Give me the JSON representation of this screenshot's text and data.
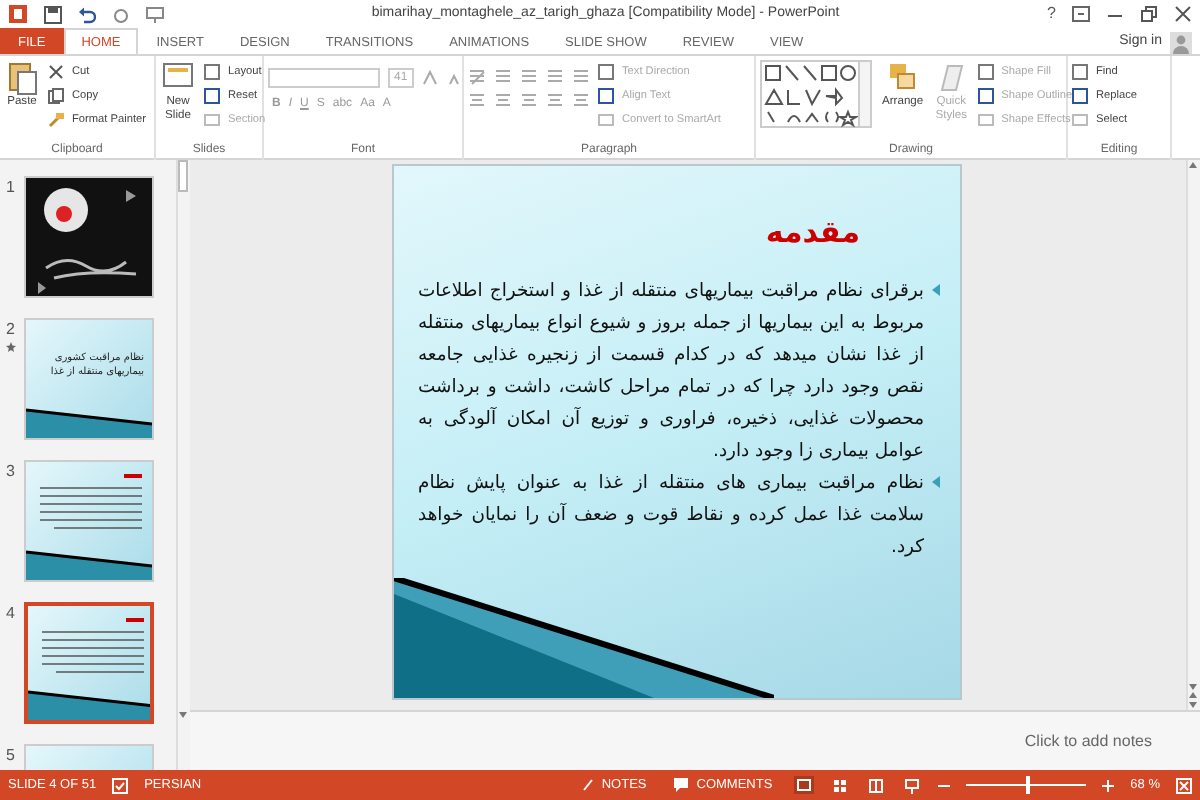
{
  "window": {
    "title": "bimarihay_montaghele_az_tarigh_ghaza [Compatibility Mode] - PowerPoint",
    "help": "?"
  },
  "tabs": [
    {
      "label": "FILE",
      "kind": "file",
      "selected": false
    },
    {
      "label": "HOME",
      "kind": "tab",
      "selected": true
    },
    {
      "label": "INSERT",
      "kind": "tab",
      "selected": false
    },
    {
      "label": "DESIGN",
      "kind": "tab",
      "selected": false
    },
    {
      "label": "TRANSITIONS",
      "kind": "tab",
      "selected": false
    },
    {
      "label": "ANIMATIONS",
      "kind": "tab",
      "selected": false
    },
    {
      "label": "SLIDE SHOW",
      "kind": "tab",
      "selected": false
    },
    {
      "label": "REVIEW",
      "kind": "tab",
      "selected": false
    },
    {
      "label": "VIEW",
      "kind": "tab",
      "selected": false
    }
  ],
  "account": {
    "label": "Sign in"
  },
  "ribbon": {
    "groups": [
      {
        "label": "Clipboard",
        "kind": "clipboard",
        "large": [
          {
            "label": "Paste",
            "disabled": false
          }
        ],
        "items": [
          {
            "label": "Cut",
            "disabled": false
          },
          {
            "label": "Copy",
            "disabled": false
          },
          {
            "label": "Format Painter",
            "disabled": false
          }
        ]
      },
      {
        "label": "Slides",
        "kind": "slides",
        "large": [
          {
            "label": "New Slide",
            "disabled": false
          }
        ],
        "items": [
          {
            "label": "Layout",
            "disabled": false
          },
          {
            "label": "Reset",
            "disabled": false
          },
          {
            "label": "Section",
            "disabled": true
          }
        ]
      },
      {
        "label": "Font",
        "kind": "font",
        "font_size": "41",
        "buttons": [
          "B",
          "I",
          "U",
          "S",
          "abc",
          "Aa",
          "A"
        ]
      },
      {
        "label": "Paragraph",
        "kind": "paragraph",
        "items": [
          {
            "label": "Text Direction",
            "disabled": true
          },
          {
            "label": "Align Text",
            "disabled": true
          },
          {
            "label": "Convert to SmartArt",
            "disabled": true
          }
        ]
      },
      {
        "label": "Drawing",
        "kind": "drawing",
        "large": [
          {
            "label": "Arrange",
            "disabled": false
          },
          {
            "label": "Quick Styles",
            "disabled": true
          }
        ],
        "items": [
          {
            "label": "Shape Fill",
            "disabled": true
          },
          {
            "label": "Shape Outline",
            "disabled": true
          },
          {
            "label": "Shape Effects",
            "disabled": true
          }
        ]
      },
      {
        "label": "Editing",
        "kind": "editing",
        "items": [
          {
            "label": "Find",
            "disabled": false
          },
          {
            "label": "Replace",
            "disabled": false
          },
          {
            "label": "Select",
            "disabled": false
          }
        ]
      }
    ]
  },
  "thumbnails": [
    {
      "number": "1",
      "kind": "picture",
      "selected": false,
      "animated": false
    },
    {
      "number": "2",
      "kind": "title",
      "title": "نظام مراقبت کشوری بیماریهای منتقله از غذا",
      "selected": false,
      "animated": true
    },
    {
      "number": "3",
      "kind": "content",
      "selected": false,
      "animated": false
    },
    {
      "number": "4",
      "kind": "content",
      "selected": true,
      "animated": false
    },
    {
      "number": "5",
      "kind": "cut_off",
      "selected": false,
      "animated": false
    }
  ],
  "slide": {
    "title": "مقدمه",
    "bullets": [
      "برقرای نظام مراقبت بیماریهای منتقله از غذا و استخراج اطلاعات مربوط به این بیماریها از جمله بروز و شیوع انواع بیماریهای منتقله از غذا نشان میدهد که در کدام قسمت از زنجیره غذایی جامعه نقص وجود دارد چرا که در تمام مراحل کاشت، داشت و برداشت محصولات غذایی، ذخیره، فراوری و توزیع آن امکان آلودگی به عوامل بیماری زا وجود دارد.",
      "نظام مراقبت بیماری های منتقله از غذا به عنوان پایش نظام سلامت غذا عمل کرده و نقاط قوت و ضعف آن را نمایان خواهد کرد."
    ]
  },
  "notes": {
    "placeholder": "Click to add notes"
  },
  "status_bar": {
    "slide": "SLIDE 4 OF 51",
    "language": "PERSIAN",
    "notes": "NOTES",
    "comments": "COMMENTS",
    "views": [
      {
        "kind": "normal",
        "selected": true
      },
      {
        "kind": "sorter",
        "selected": false
      },
      {
        "kind": "reading",
        "selected": false
      },
      {
        "kind": "slideshow",
        "selected": false
      }
    ],
    "zoom": {
      "level": 0.5,
      "reading": "68 %"
    }
  }
}
